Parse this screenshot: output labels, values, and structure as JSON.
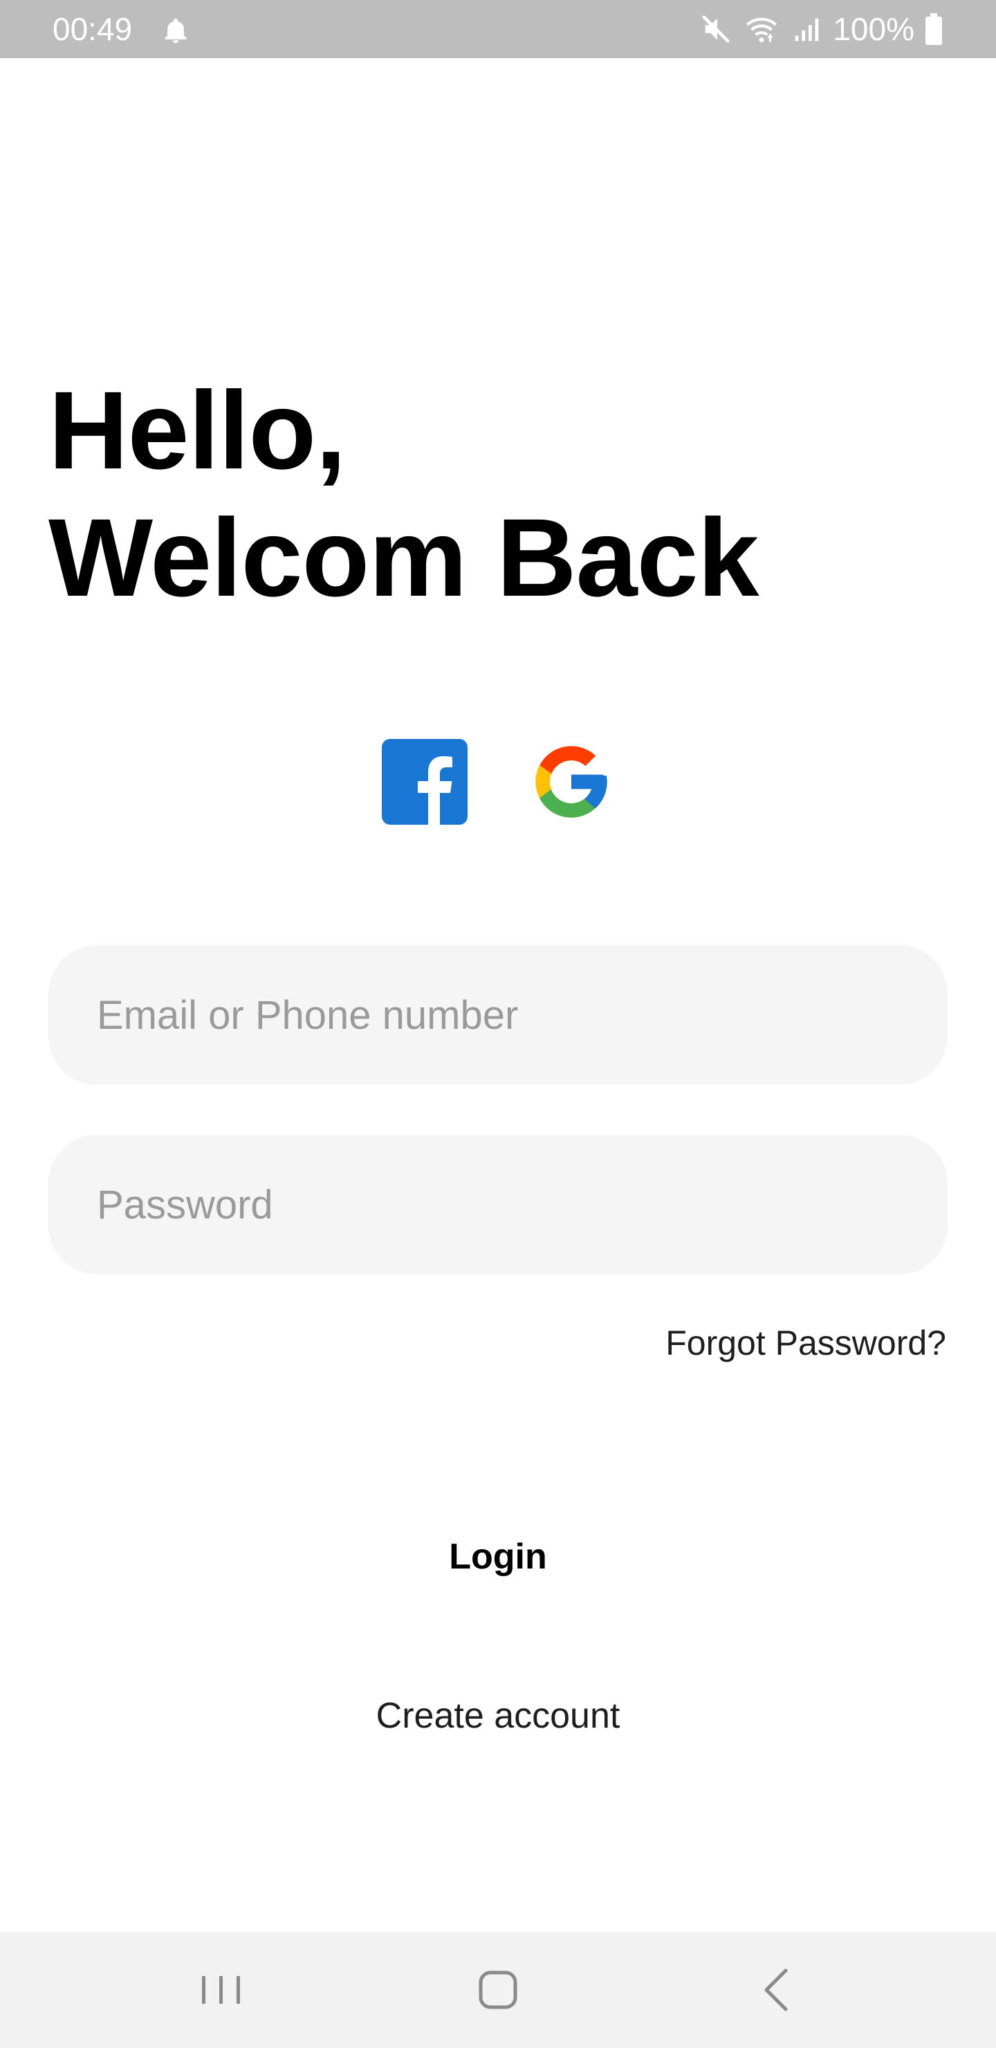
{
  "status_bar": {
    "time": "00:49",
    "battery": "100%",
    "icons": [
      "bell-icon",
      "mute-icon",
      "wifi-icon",
      "signal-icon",
      "battery-icon"
    ]
  },
  "heading": {
    "line1": "Hello,",
    "line2": "Welcom Back"
  },
  "social": {
    "facebook_icon": "facebook-icon",
    "google_icon": "google-icon",
    "colors": {
      "facebook": "#1976D2",
      "google_red": "#EA4335",
      "google_yellow": "#FBBC05",
      "google_green": "#34A853",
      "google_blue": "#4285F4"
    }
  },
  "form": {
    "email_placeholder": "Email or Phone number",
    "email_value": "",
    "password_placeholder": "Password",
    "password_value": "",
    "forgot_label": "Forgot Password?"
  },
  "actions": {
    "login_label": "Login",
    "create_account_label": "Create account"
  },
  "nav_bar": {
    "icons": [
      "recent-apps-icon",
      "home-icon",
      "back-icon"
    ]
  },
  "colors": {
    "status_bar_bg": "#BDBDBD",
    "input_bg": "#F5F5F5",
    "placeholder": "#9A9A9A",
    "nav_bar_bg": "#F2F2F2"
  }
}
